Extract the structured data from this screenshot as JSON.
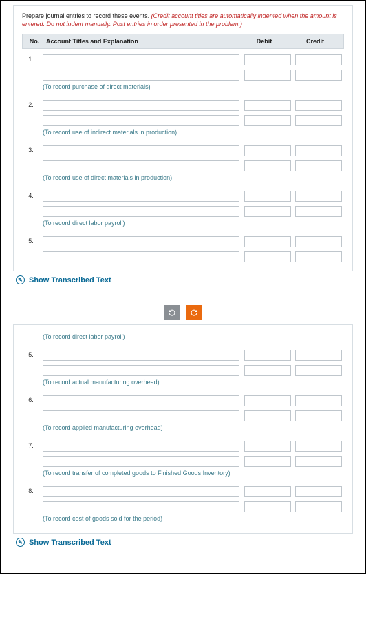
{
  "instructions": {
    "text_a": "Prepare journal entries to record these events. ",
    "text_b": "(Credit account titles are automatically indented when the amount is entered. Do not indent manually. Post entries in order presented in the problem.)"
  },
  "columns": {
    "no": "No.",
    "acct": "Account Titles and Explanation",
    "debit": "Debit",
    "credit": "Credit"
  },
  "panel1": {
    "entries": [
      {
        "no": "1.",
        "caption": "(To record purchase of direct materials)"
      },
      {
        "no": "2.",
        "caption": "(To record use of indirect materials in production)"
      },
      {
        "no": "3.",
        "caption": "(To record use of direct materials in production)"
      },
      {
        "no": "4.",
        "caption": "(To record direct labor payroll)"
      },
      {
        "no": "5.",
        "caption": ""
      }
    ]
  },
  "panel2": {
    "top_caption": "(To record direct labor payroll)",
    "entries": [
      {
        "no": "5.",
        "caption": "(To record actual manufacturing overhead)"
      },
      {
        "no": "6.",
        "caption": "(To record applied manufacturing overhead)"
      },
      {
        "no": "7.",
        "caption": "(To record transfer of completed goods to Finished Goods Inventory)"
      },
      {
        "no": "8.",
        "caption": "(To record cost of goods sold for the period)"
      }
    ]
  },
  "show_transcribed": "Show Transcribed Text"
}
